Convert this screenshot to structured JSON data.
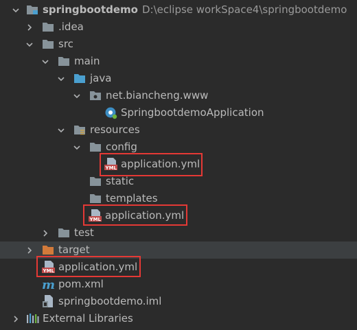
{
  "project": {
    "name": "springbootdemo",
    "path": "D:\\eclipse workSpace4\\springbootdemo"
  },
  "tree": {
    "idea": ".idea",
    "src": "src",
    "main": "main",
    "java": "java",
    "package": "net.biancheng.www",
    "app_class": "SpringbootdemoApplication",
    "resources": "resources",
    "config": "config",
    "config_yml": "application.yml",
    "static": "static",
    "templates": "templates",
    "resources_yml": "application.yml",
    "test": "test",
    "target": "target",
    "root_yml": "application.yml",
    "pom": "pom.xml",
    "iml": "springbootdemo.iml",
    "ext_libs": "External Libraries"
  },
  "colors": {
    "background": "#2b2b2b",
    "highlight_row": "#3c3f41",
    "folder": "#87939a",
    "source_folder": "#4a9fcf",
    "target_folder": "#d27a3a",
    "annotation_box": "#e53935"
  }
}
